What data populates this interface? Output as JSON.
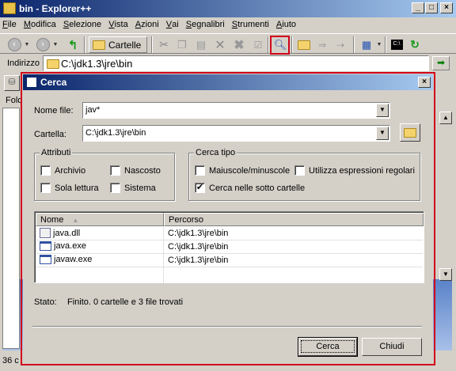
{
  "window": {
    "title": "bin - Explorer++"
  },
  "menu": [
    {
      "mnemonic": "F",
      "rest": "ile"
    },
    {
      "mnemonic": "M",
      "rest": "odifica"
    },
    {
      "mnemonic": "S",
      "rest": "elezione",
      "pre": ""
    },
    {
      "mnemonic": "V",
      "rest": "ista"
    },
    {
      "mnemonic": "A",
      "rest": "zioni"
    },
    {
      "mnemonic": "V",
      "rest": "ai"
    },
    {
      "mnemonic": "S",
      "rest": "egnalibri"
    },
    {
      "mnemonic": "S",
      "rest": "trumenti"
    },
    {
      "mnemonic": "A",
      "rest": "iuto"
    }
  ],
  "toolbar": {
    "folders_button": "Cartelle"
  },
  "address": {
    "label": "Indirizzo",
    "value": "C:\\jdk1.3\\jre\\bin"
  },
  "background": {
    "folders_label": "Fold",
    "status_left": "36 c"
  },
  "dialog": {
    "title": "Cerca",
    "filename_label": "Nome file:",
    "filename_value": "jav*",
    "folder_label": "Cartella:",
    "folder_value": "C:\\jdk1.3\\jre\\bin",
    "attributes": {
      "title": "Attributi",
      "archive": {
        "label": "Archivio",
        "checked": false
      },
      "hidden": {
        "label": "Nascosto",
        "checked": false
      },
      "readonly": {
        "label": "Sola lettura",
        "checked": false
      },
      "system": {
        "label": "Sistema",
        "checked": false
      }
    },
    "search_type": {
      "title": "Cerca tipo",
      "case_sensitive": {
        "label": "Maiuscole/minuscole",
        "checked": false
      },
      "regex": {
        "label": "Utilizza espressioni regolari",
        "checked": false
      },
      "subfolders": {
        "label": "Cerca nelle sotto cartelle",
        "checked": true
      }
    },
    "results": {
      "columns": [
        "Nome",
        "Percorso"
      ],
      "rows": [
        {
          "name": "java.dll",
          "path": "C:\\jdk1.3\\jre\\bin",
          "icon": "dll-file-icon"
        },
        {
          "name": "java.exe",
          "path": "C:\\jdk1.3\\jre\\bin",
          "icon": "exe-file-icon"
        },
        {
          "name": "javaw.exe",
          "path": "C:\\jdk1.3\\jre\\bin",
          "icon": "exe-file-icon"
        }
      ]
    },
    "status_label": "Stato:",
    "status_value": "Finito. 0 cartelle e 3 file trovati",
    "search_button": "Cerca",
    "close_button": "Chiudi"
  },
  "colors": {
    "highlight": "#d0021b",
    "titlebar": "#0a246a"
  }
}
